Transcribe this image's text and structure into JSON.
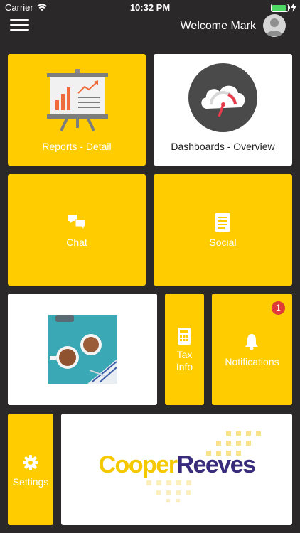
{
  "status_bar": {
    "carrier": "Carrier",
    "time": "10:32 PM",
    "battery_level": 0.9,
    "battery_color": "#4cd964"
  },
  "header": {
    "menu_icon": "hamburger-icon",
    "welcome": "Welcome Mark",
    "avatar_icon": "user-avatar-icon"
  },
  "tiles": {
    "reports": {
      "label": "Reports - Detail",
      "icon": "presentation-board-icon"
    },
    "dashboards": {
      "label": "Dashboards - Overview",
      "icon": "cloud-gauge-icon"
    },
    "chat": {
      "label": "Chat",
      "icon": "chat-bubbles-icon"
    },
    "social": {
      "label": "Social",
      "icon": "newspaper-icon"
    },
    "coffee": {
      "icon": "coffee-photo"
    },
    "tax": {
      "label": "Tax\nInfo",
      "icon": "calculator-icon"
    },
    "notifications": {
      "label": "Notifications",
      "badge": "1",
      "icon": "bell-icon"
    },
    "settings": {
      "label": "Settings",
      "icon": "gear-icon"
    },
    "brand": {
      "text_part1": "Cooper",
      "text_part2": "Reeves",
      "color1": "#f5c800",
      "color2": "#3a2c7c"
    }
  },
  "colors": {
    "background": "#2a2828",
    "tile_yellow": "#ffcc00",
    "tile_white": "#ffffff",
    "badge_red": "#e03a3a"
  }
}
